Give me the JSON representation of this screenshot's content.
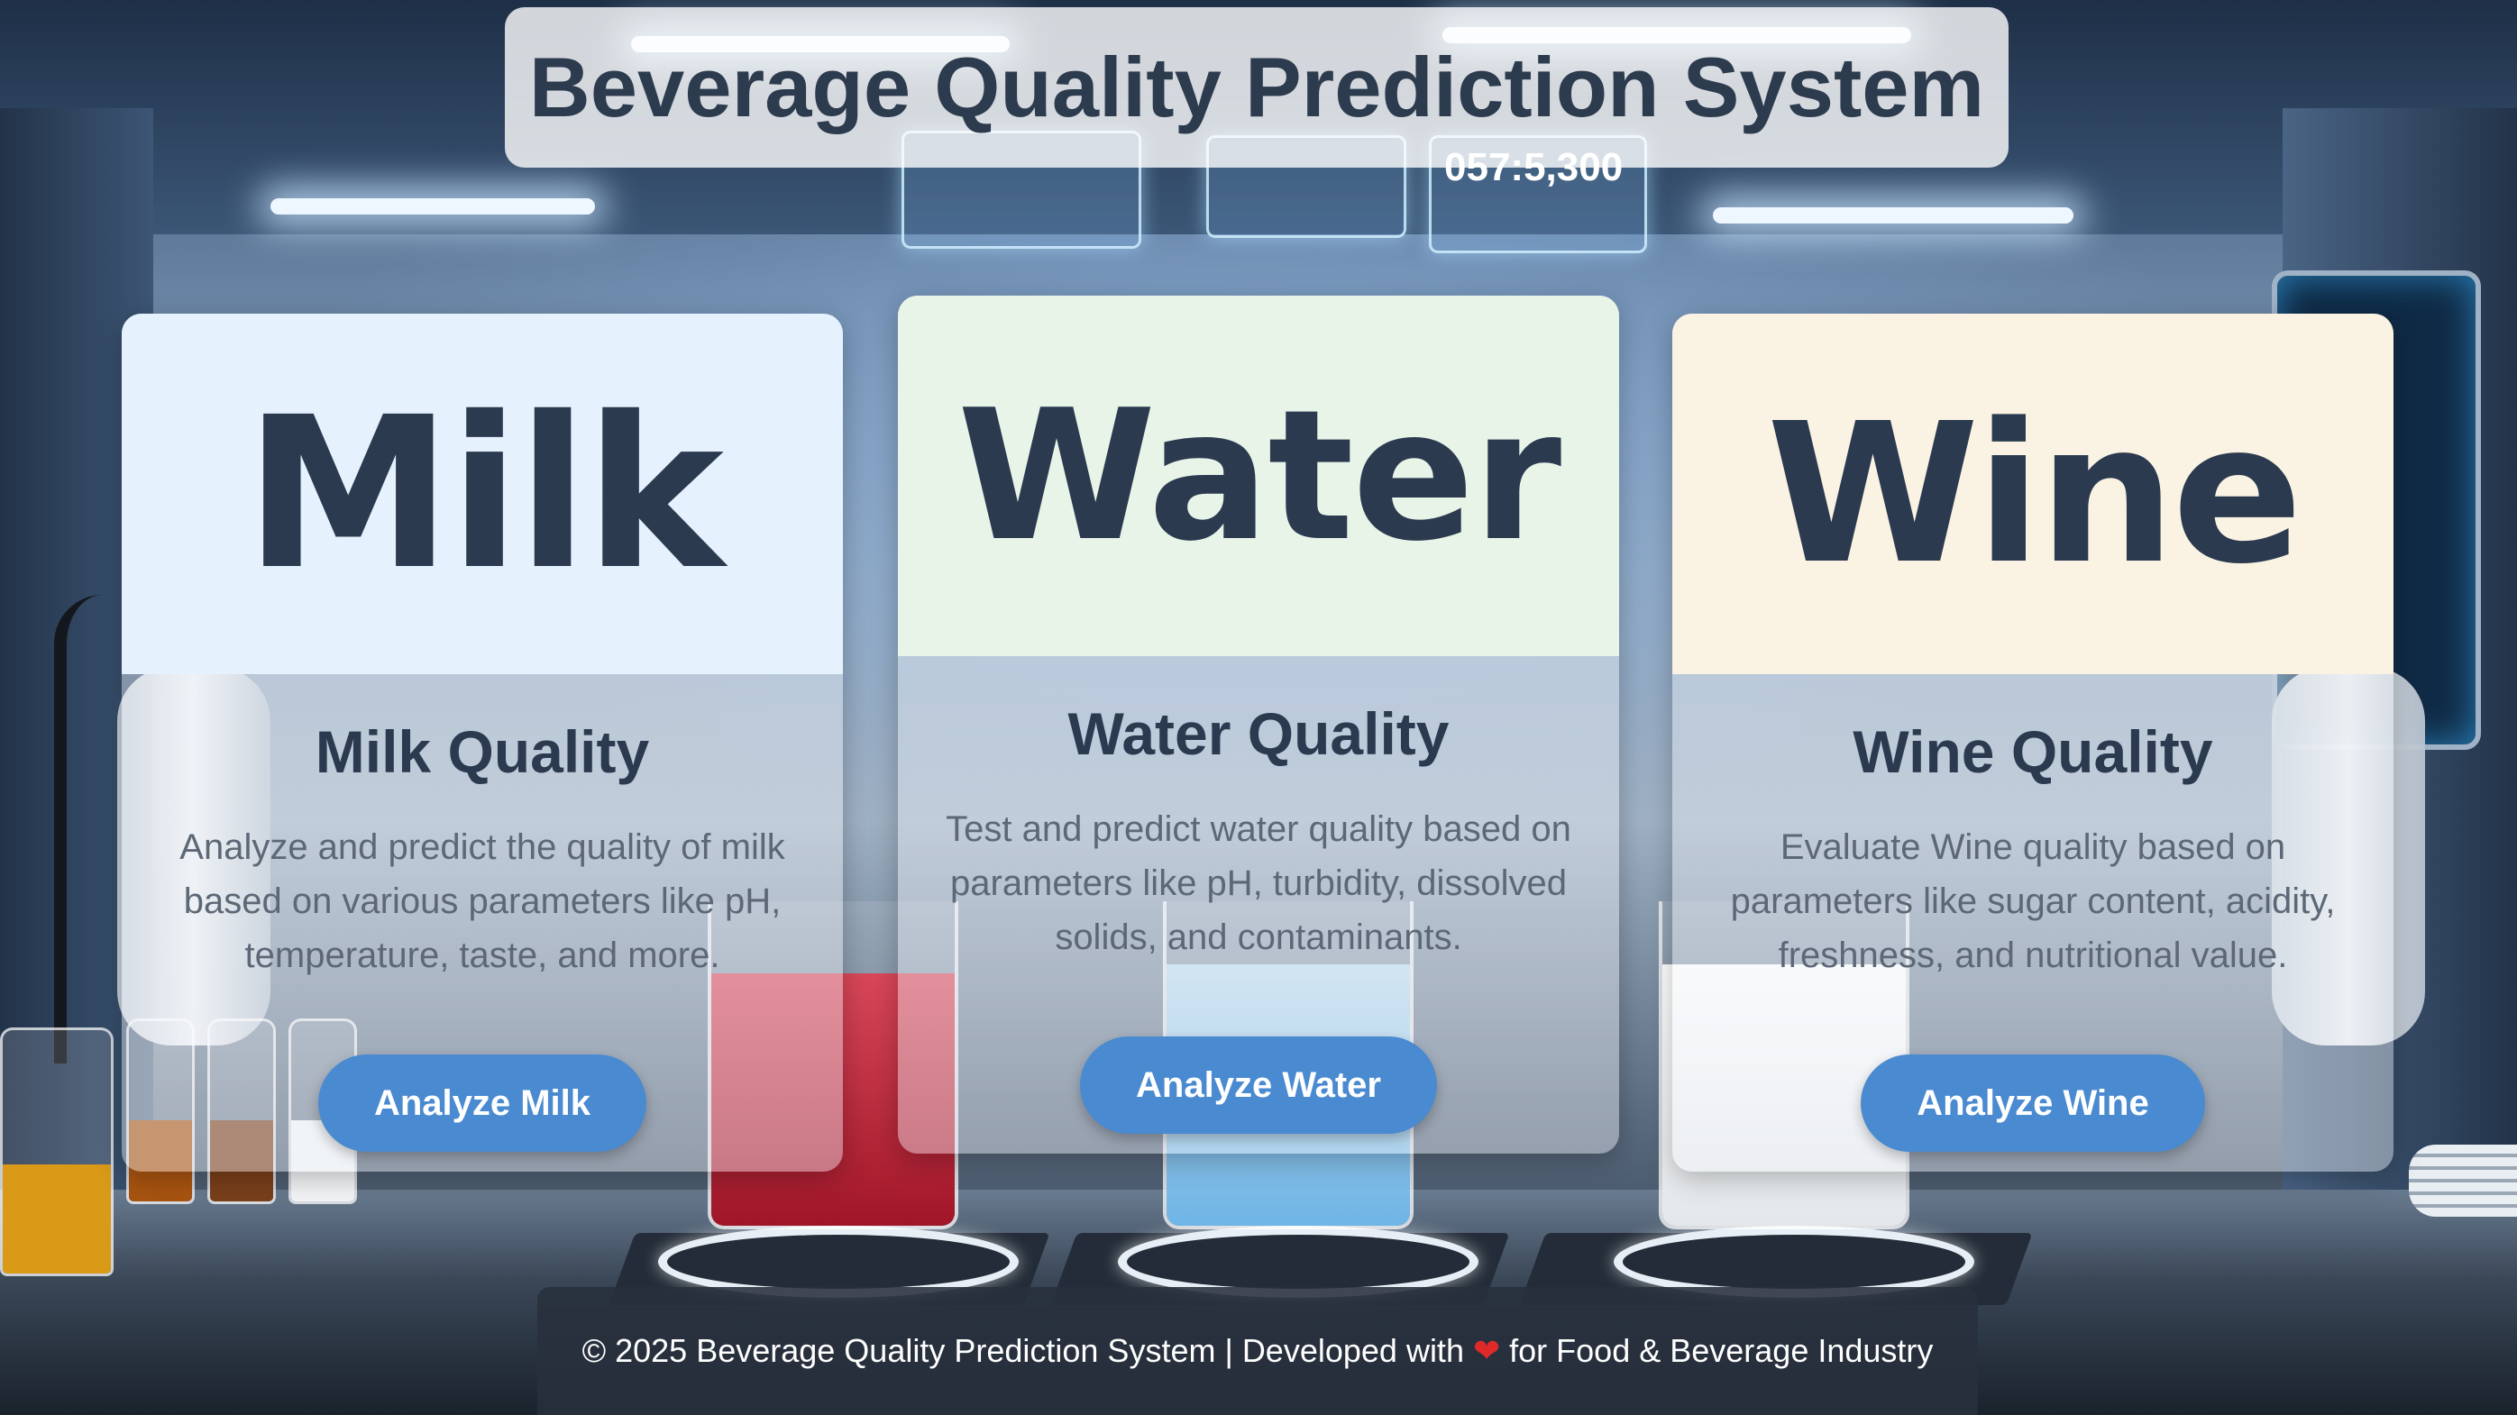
{
  "header": {
    "title": "Beverage Quality Prediction System"
  },
  "cards": {
    "milk": {
      "banner": "Milk",
      "title": "Milk Quality",
      "description": "Analyze and predict the quality of milk based on various parameters like pH, temperature, taste, and more.",
      "button": "Analyze Milk",
      "banner_color": "#e5f1fd"
    },
    "water": {
      "banner": "Water",
      "title": "Water Quality",
      "description": "Test and predict water quality based on parameters like pH, turbidity, dissolved solids, and contaminants.",
      "button": "Analyze Water",
      "banner_color": "#e9f4e9"
    },
    "wine": {
      "banner": "Wine",
      "title": "Wine Quality",
      "description": "Evaluate Wine quality based on parameters like sugar content, acidity, freshness, and nutritional value.",
      "button": "Analyze Wine",
      "banner_color": "#faf3e3"
    }
  },
  "footer": {
    "text_before": "© 2025 Beverage Quality Prediction System | Developed with ",
    "heart": "❤",
    "text_after": " for Food & Beverage Industry"
  },
  "hologram": {
    "readout": "057:5,300"
  },
  "colors": {
    "button": "#4a8ad0",
    "heading": "#2b3a4f",
    "footer_bg": "#28303c"
  }
}
